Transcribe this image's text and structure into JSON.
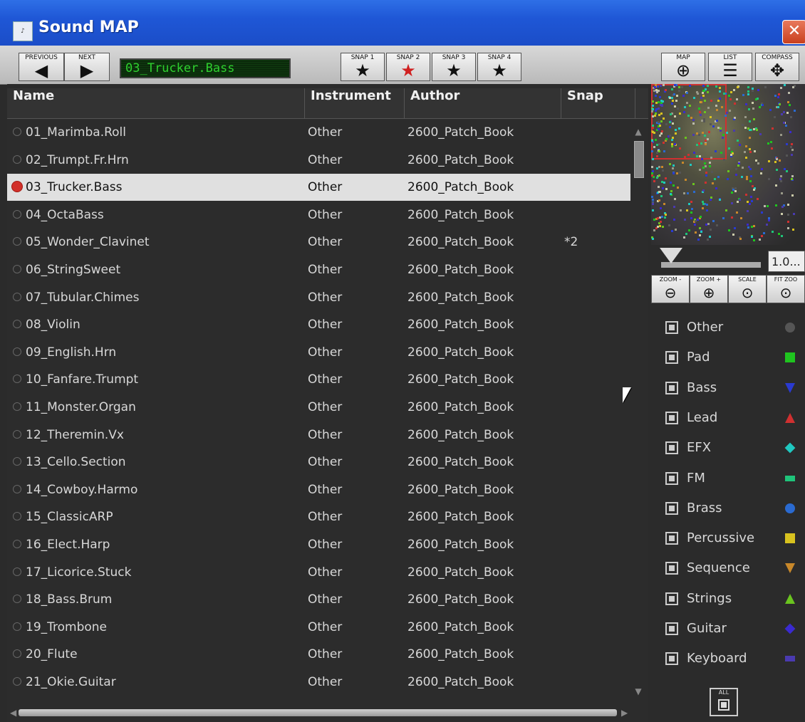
{
  "window": {
    "title": "Sound MAP",
    "close_glyph": "✕",
    "icon_name": "app-icon"
  },
  "toolbar": {
    "previous_label": "PREVIOUS",
    "next_label": "NEXT",
    "current_patch": "03_Trucker.Bass",
    "snaps": [
      {
        "label": "SNAP 1",
        "active": false
      },
      {
        "label": "SNAP 2",
        "active": true
      },
      {
        "label": "SNAP 3",
        "active": false
      },
      {
        "label": "SNAP 4",
        "active": false
      }
    ],
    "views": [
      {
        "label": "MAP"
      },
      {
        "label": "LIST"
      },
      {
        "label": "COMPASS"
      }
    ]
  },
  "columns": {
    "name": "Name",
    "instrument": "Instrument",
    "author": "Author",
    "snap": "Snap"
  },
  "rows": [
    {
      "name": "01_Marimba.Roll",
      "instrument": "Other",
      "author": "2600_Patch_Book",
      "snap": ""
    },
    {
      "name": "02_Trumpt.Fr.Hrn",
      "instrument": "Other",
      "author": "2600_Patch_Book",
      "snap": ""
    },
    {
      "name": "03_Trucker.Bass",
      "instrument": "Other",
      "author": "2600_Patch_Book",
      "snap": "",
      "selected": true
    },
    {
      "name": "04_OctaBass",
      "instrument": "Other",
      "author": "2600_Patch_Book",
      "snap": ""
    },
    {
      "name": "05_Wonder_Clavinet",
      "instrument": "Other",
      "author": "2600_Patch_Book",
      "snap": "*2"
    },
    {
      "name": "06_StringSweet",
      "instrument": "Other",
      "author": "2600_Patch_Book",
      "snap": ""
    },
    {
      "name": "07_Tubular.Chimes",
      "instrument": "Other",
      "author": "2600_Patch_Book",
      "snap": ""
    },
    {
      "name": "08_Violin",
      "instrument": "Other",
      "author": "2600_Patch_Book",
      "snap": ""
    },
    {
      "name": "09_English.Hrn",
      "instrument": "Other",
      "author": "2600_Patch_Book",
      "snap": ""
    },
    {
      "name": "10_Fanfare.Trumpt",
      "instrument": "Other",
      "author": "2600_Patch_Book",
      "snap": ""
    },
    {
      "name": "11_Monster.Organ",
      "instrument": "Other",
      "author": "2600_Patch_Book",
      "snap": ""
    },
    {
      "name": "12_Theremin.Vx",
      "instrument": "Other",
      "author": "2600_Patch_Book",
      "snap": ""
    },
    {
      "name": "13_Cello.Section",
      "instrument": "Other",
      "author": "2600_Patch_Book",
      "snap": ""
    },
    {
      "name": "14_Cowboy.Harmo",
      "instrument": "Other",
      "author": "2600_Patch_Book",
      "snap": ""
    },
    {
      "name": "15_ClassicARP",
      "instrument": "Other",
      "author": "2600_Patch_Book",
      "snap": ""
    },
    {
      "name": "16_Elect.Harp",
      "instrument": "Other",
      "author": "2600_Patch_Book",
      "snap": ""
    },
    {
      "name": "17_Licorice.Stuck",
      "instrument": "Other",
      "author": "2600_Patch_Book",
      "snap": ""
    },
    {
      "name": "18_Bass.Brum",
      "instrument": "Other",
      "author": "2600_Patch_Book",
      "snap": ""
    },
    {
      "name": "19_Trombone",
      "instrument": "Other",
      "author": "2600_Patch_Book",
      "snap": ""
    },
    {
      "name": "20_Flute",
      "instrument": "Other",
      "author": "2600_Patch_Book",
      "snap": ""
    },
    {
      "name": "21_Okie.Guitar",
      "instrument": "Other",
      "author": "2600_Patch_Book",
      "snap": ""
    }
  ],
  "map_controls": {
    "zoom_value": "1.0...",
    "buttons": [
      {
        "label": "ZOOM -"
      },
      {
        "label": "ZOOM +"
      },
      {
        "label": "SCALE"
      },
      {
        "label": "FIT ZOO"
      }
    ]
  },
  "legend": [
    {
      "label": "Other",
      "marker": "circle",
      "color": "#555555"
    },
    {
      "label": "Pad",
      "marker": "square",
      "color": "#1fc41f"
    },
    {
      "label": "Bass",
      "marker": "triangle-down",
      "color": "#2a3ad0"
    },
    {
      "label": "Lead",
      "marker": "triangle-up",
      "color": "#d03030"
    },
    {
      "label": "EFX",
      "marker": "diamond",
      "color": "#1fc8c0"
    },
    {
      "label": "FM",
      "marker": "rect",
      "color": "#1fc47a"
    },
    {
      "label": "Brass",
      "marker": "circle",
      "color": "#2a6ad0"
    },
    {
      "label": "Percussive",
      "marker": "square",
      "color": "#d8c21f"
    },
    {
      "label": "Sequence",
      "marker": "triangle-down",
      "color": "#c8882a"
    },
    {
      "label": "Strings",
      "marker": "triangle-up",
      "color": "#6ac41f"
    },
    {
      "label": "Guitar",
      "marker": "diamond",
      "color": "#3a2ad0"
    },
    {
      "label": "Keyboard",
      "marker": "rect",
      "color": "#4a3ab0"
    }
  ],
  "all_label": "ALL"
}
